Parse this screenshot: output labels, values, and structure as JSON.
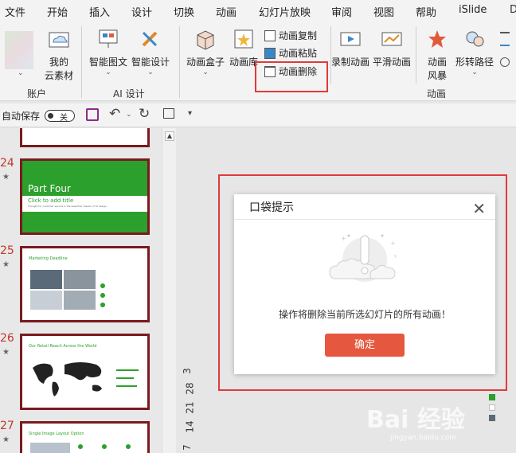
{
  "menu": [
    "文件",
    "开始",
    "插入",
    "设计",
    "切换",
    "动画",
    "幻灯片放映",
    "审阅",
    "视图",
    "帮助",
    "iSlide",
    "D"
  ],
  "ribbon": {
    "account_group": {
      "label": "账户",
      "items": [
        "我的",
        "云素材"
      ]
    },
    "ai_group": {
      "label": "AI 设计",
      "items": [
        "智能图文",
        "智能设计"
      ]
    },
    "animation_group": {
      "label": "动画",
      "box": "动画盒子",
      "library": "动画库",
      "copy": "动画复制",
      "paste": "动画粘贴",
      "delete": "动画删除",
      "record": "录制动画",
      "smooth": "平滑动画",
      "style1": "动画",
      "style2": "风暴",
      "path": "形转路径"
    }
  },
  "qat": {
    "autosave": "自动保存",
    "toggle_state": "关"
  },
  "slides": [
    {
      "num": "24",
      "title": "Part Four",
      "sub": "Click to add title",
      "desc": "Thought for customer service is the essential mission of AI design."
    },
    {
      "num": "25",
      "title": "Marketing Deadline"
    },
    {
      "num": "26",
      "title": "Our Retail Reach Across the World"
    },
    {
      "num": "27",
      "title": "Single Image Layout Option"
    }
  ],
  "ruler": [
    "3",
    "28",
    "21",
    "14",
    "7"
  ],
  "dialog": {
    "title": "口袋提示",
    "message": "操作将删除当前所选幻灯片的所有动画！",
    "ok": "确定"
  },
  "watermark": {
    "brand": "Bai 经验",
    "url": "jingyan.baidu.com"
  }
}
